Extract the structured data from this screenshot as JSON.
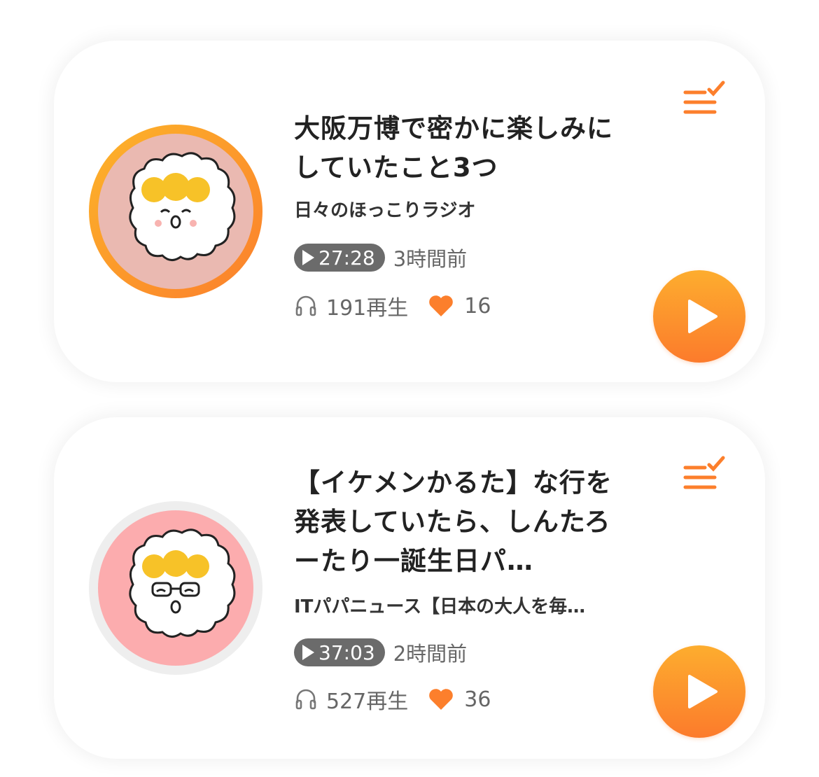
{
  "episodes": [
    {
      "title": "大阪万博で密かに楽しみにしていたこと3つ",
      "channel": "日々のほっこりラジオ",
      "duration": "27:28",
      "posted": "3時間前",
      "plays": "191再生",
      "likes": "16",
      "avatar_icon": "smiling-character-avatar"
    },
    {
      "title": "【イケメンかるた】な行を発表していたら、しんたろーたり一誕生日パ…",
      "channel": "ITパパニュース【日本の大人を毎…",
      "duration": "37:03",
      "posted": "2時間前",
      "plays": "527再生",
      "likes": "36",
      "avatar_icon": "glasses-character-avatar"
    }
  ],
  "colors": {
    "accent": "#fc8a2c",
    "duration_badge": "#6b6b6b",
    "text_primary": "#222222",
    "text_secondary": "#666666"
  }
}
